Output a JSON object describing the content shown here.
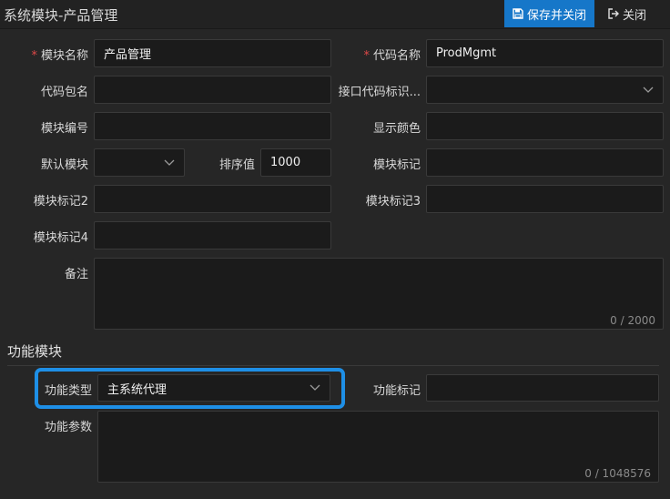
{
  "header": {
    "title": "系统模块-产品管理",
    "save_close_label": "保存并关闭",
    "close_label": "关闭"
  },
  "form": {
    "module_name": {
      "label": "模块名称",
      "value": "产品管理",
      "required": true
    },
    "code_name": {
      "label": "代码名称",
      "value": "ProdMgmt",
      "required": true
    },
    "code_package": {
      "label": "代码包名",
      "value": ""
    },
    "interface_code_id": {
      "label": "接口代码标识...",
      "value": ""
    },
    "module_number": {
      "label": "模块编号",
      "value": ""
    },
    "display_color": {
      "label": "显示颜色",
      "value": ""
    },
    "default_module": {
      "label": "默认模块",
      "value": ""
    },
    "sort_value": {
      "label": "排序值",
      "value": "1000"
    },
    "module_tag": {
      "label": "模块标记",
      "value": ""
    },
    "module_tag2": {
      "label": "模块标记2",
      "value": ""
    },
    "module_tag3": {
      "label": "模块标记3",
      "value": ""
    },
    "module_tag4": {
      "label": "模块标记4",
      "value": ""
    },
    "remarks": {
      "label": "备注",
      "value": "",
      "counter": "0 / 2000"
    }
  },
  "function_section": {
    "title": "功能模块",
    "function_type": {
      "label": "功能类型",
      "value": "主系统代理"
    },
    "function_tag": {
      "label": "功能标记",
      "value": ""
    },
    "function_params": {
      "label": "功能参数",
      "value": "",
      "counter": "0 / 1048576"
    }
  },
  "colors": {
    "accent": "#1677c9",
    "highlight": "#1e8fe6",
    "required": "#e04848"
  }
}
